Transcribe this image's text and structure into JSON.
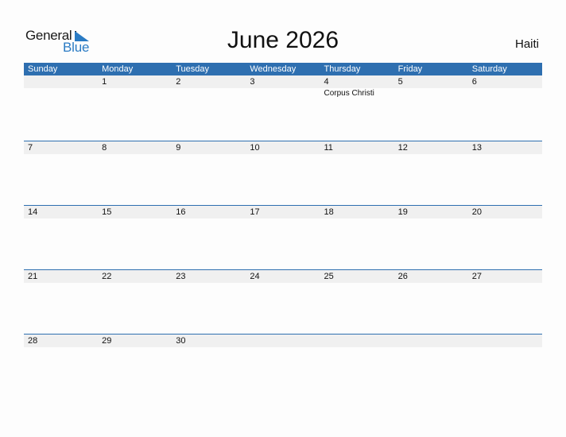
{
  "brand": {
    "line1": "General",
    "line2": "Blue",
    "icon": "triangle-flag-icon",
    "accent": "#2a7bc4"
  },
  "title": "June 2026",
  "country": "Haiti",
  "colors": {
    "header_bg": "#2e6fb0",
    "strip_bg": "#f0f0f0"
  },
  "weekdays": [
    "Sunday",
    "Monday",
    "Tuesday",
    "Wednesday",
    "Thursday",
    "Friday",
    "Saturday"
  ],
  "weeks": [
    {
      "days": [
        "",
        "1",
        "2",
        "3",
        "4",
        "5",
        "6"
      ],
      "events": [
        "",
        "",
        "",
        "",
        "Corpus Christi",
        "",
        ""
      ]
    },
    {
      "days": [
        "7",
        "8",
        "9",
        "10",
        "11",
        "12",
        "13"
      ],
      "events": [
        "",
        "",
        "",
        "",
        "",
        "",
        ""
      ]
    },
    {
      "days": [
        "14",
        "15",
        "16",
        "17",
        "18",
        "19",
        "20"
      ],
      "events": [
        "",
        "",
        "",
        "",
        "",
        "",
        ""
      ]
    },
    {
      "days": [
        "21",
        "22",
        "23",
        "24",
        "25",
        "26",
        "27"
      ],
      "events": [
        "",
        "",
        "",
        "",
        "",
        "",
        ""
      ]
    },
    {
      "days": [
        "28",
        "29",
        "30",
        "",
        "",
        "",
        ""
      ],
      "events": [
        "",
        "",
        "",
        "",
        "",
        "",
        ""
      ]
    }
  ]
}
